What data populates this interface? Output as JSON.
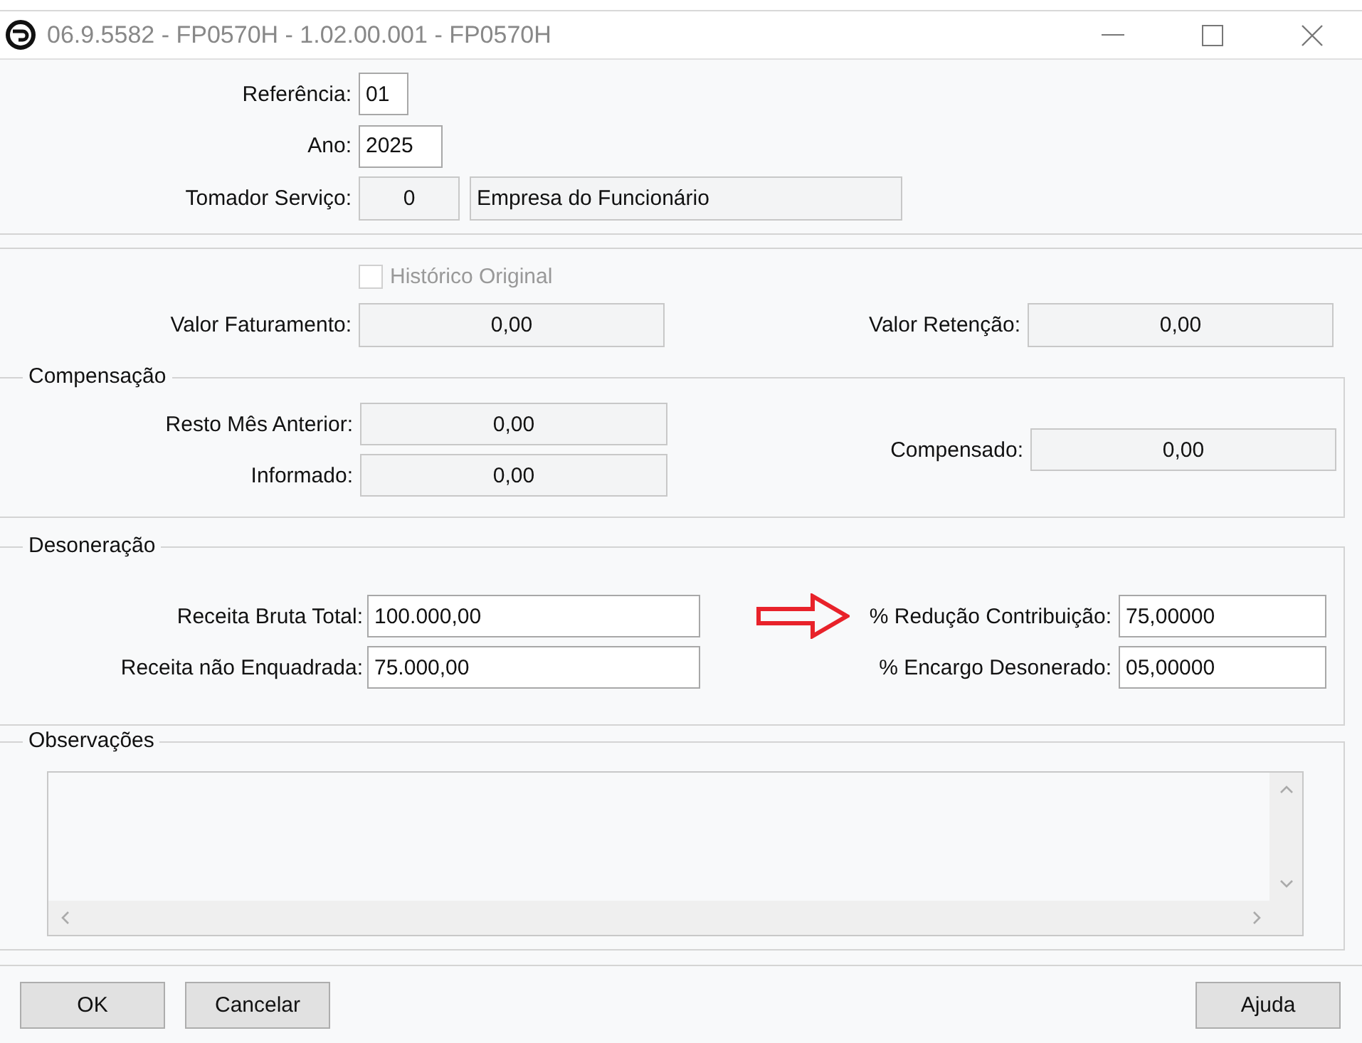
{
  "window": {
    "title": "06.9.5582 - FP0570H - 1.02.00.001 - FP0570H"
  },
  "header": [
    {
      "label": "Referência:",
      "fields": [
        "01"
      ]
    },
    {
      "label": "Ano:",
      "fields": [
        "2025"
      ]
    },
    {
      "label": "Tomador Serviço:",
      "fields": [
        "0",
        "Empresa do Funcionário"
      ]
    }
  ],
  "historico": {
    "label": "Histórico Original",
    "checked": false,
    "disabled": true
  },
  "valores": [
    {
      "label": "Valor Faturamento:",
      "value": "0,00"
    },
    {
      "label": "Valor Retenção:",
      "value": "0,00"
    }
  ],
  "compensacao": {
    "title": "Compensação",
    "left": [
      {
        "label": "Resto Mês Anterior:",
        "value": "0,00"
      },
      {
        "label": "Informado:",
        "value": "0,00"
      }
    ],
    "right": {
      "label": "Compensado:",
      "value": "0,00"
    }
  },
  "desoneracao": {
    "title": "Desoneração",
    "left": [
      {
        "label": "Receita Bruta Total:",
        "value": "100.000,00"
      },
      {
        "label": "Receita não Enquadrada:",
        "value": "75.000,00"
      }
    ],
    "right": [
      {
        "label": "% Redução Contribuição:",
        "value": "75,00000",
        "highlighted": true
      },
      {
        "label": "% Encargo Desonerado:",
        "value": "05,00000",
        "highlighted": false
      }
    ]
  },
  "observacoes": {
    "title": "Observações"
  },
  "buttons_left": [
    "OK",
    "Cancelar"
  ],
  "buttons_right": [
    "Ajuda"
  ]
}
